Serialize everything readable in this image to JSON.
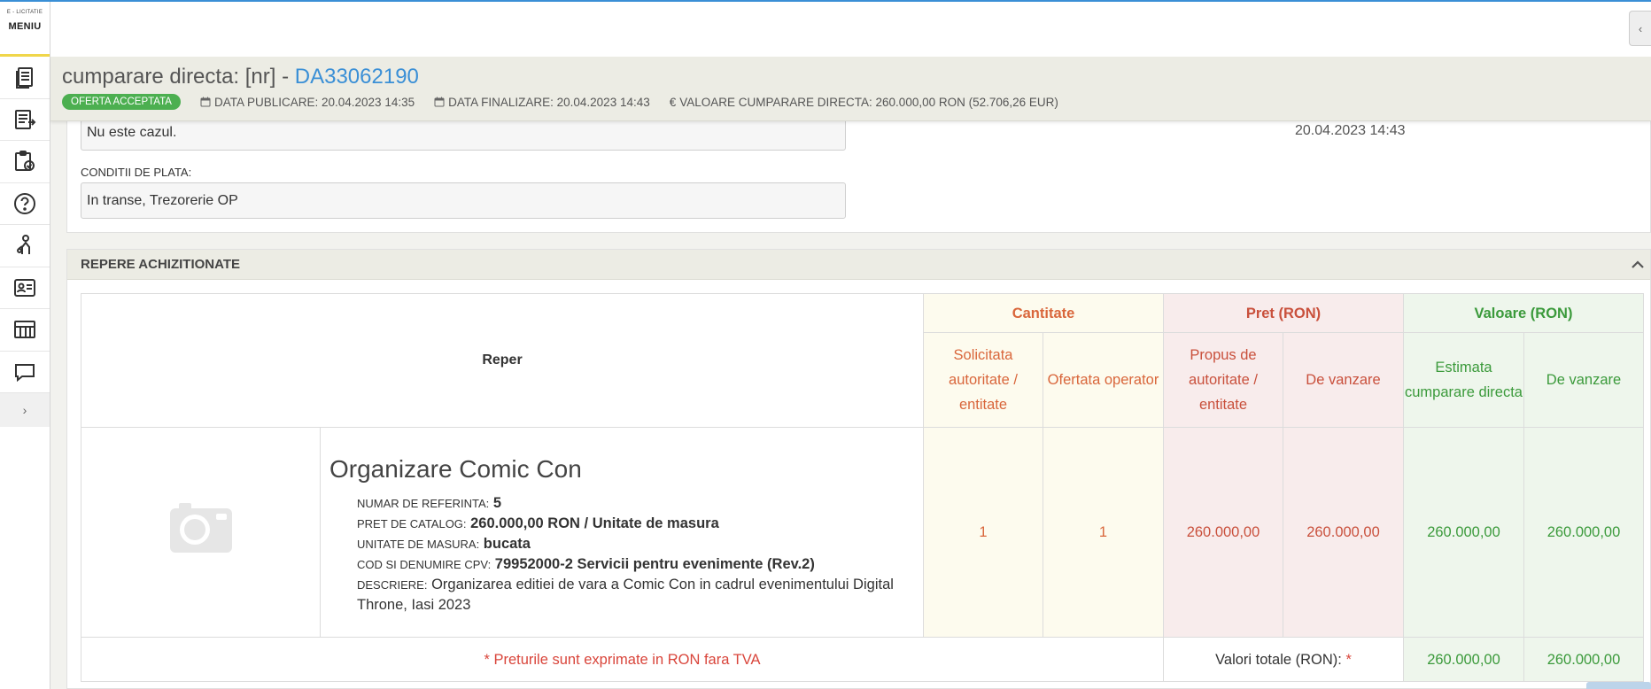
{
  "sidebar": {
    "logo_sub": "E - LICITATIE",
    "logo_main": "MENIU",
    "expand": "›"
  },
  "topbar": {
    "collapse": "‹"
  },
  "header": {
    "title_prefix": "cumparare directa: [nr] - ",
    "title_id": "DA33062190",
    "status_badge": "OFERTA ACCEPTATA",
    "publish_date": "DATA PUBLICARE: 20.04.2023 14:35",
    "end_date": "DATA FINALIZARE: 20.04.2023 14:43",
    "value": "VALOARE CUMPARARE DIRECTA: 260.000,00  RON (52.706,26  EUR)"
  },
  "panel": {
    "prev_value": "Nu este cazul.",
    "payment_label": "CONDITII DE PLATA:",
    "payment_value": "In transe, Trezorerie OP",
    "right_date": "20.04.2023 14:43"
  },
  "items_section": {
    "title": "REPERE ACHIZITIONATE",
    "headers": {
      "reper": "Reper",
      "qty_group": "Cantitate",
      "price_group": "Pret (RON)",
      "value_group": "Valoare (RON)",
      "qty_requested": "Solicitata autoritate / entitate",
      "qty_offered": "Ofertata operator",
      "price_proposed": "Propus de autoritate / entitate",
      "price_sale": "De vanzare",
      "value_estimated": "Estimata cumparare directa",
      "value_sale": "De vanzare"
    },
    "item": {
      "name": "Organizare Comic Con",
      "ref_label": "NUMAR DE REFERINTA:",
      "ref_value": "5",
      "catalog_label": "PRET DE CATALOG:",
      "catalog_value": "260.000,00  RON / Unitate de masura",
      "unit_label": "UNITATE DE MASURA:",
      "unit_value": "bucata",
      "cpv_label": "COD SI DENUMIRE CPV:",
      "cpv_value": "79952000-2 Servicii pentru evenimente (Rev.2)",
      "desc_label": "DESCRIERE:",
      "desc_value": "Organizarea editiei de vara a Comic Con in cadrul evenimentului Digital Throne, Iasi 2023",
      "qty_requested": "1",
      "qty_offered": "1",
      "price_proposed": "260.000,00",
      "price_sale": "260.000,00",
      "value_estimated": "260.000,00",
      "value_sale": "260.000,00"
    },
    "footer": {
      "note": "* Preturile sunt exprimate in RON fara TVA",
      "total_label": "Valori totale (RON):",
      "total_star": "*",
      "total_estimated": "260.000,00",
      "total_sale": "260.000,00"
    }
  }
}
